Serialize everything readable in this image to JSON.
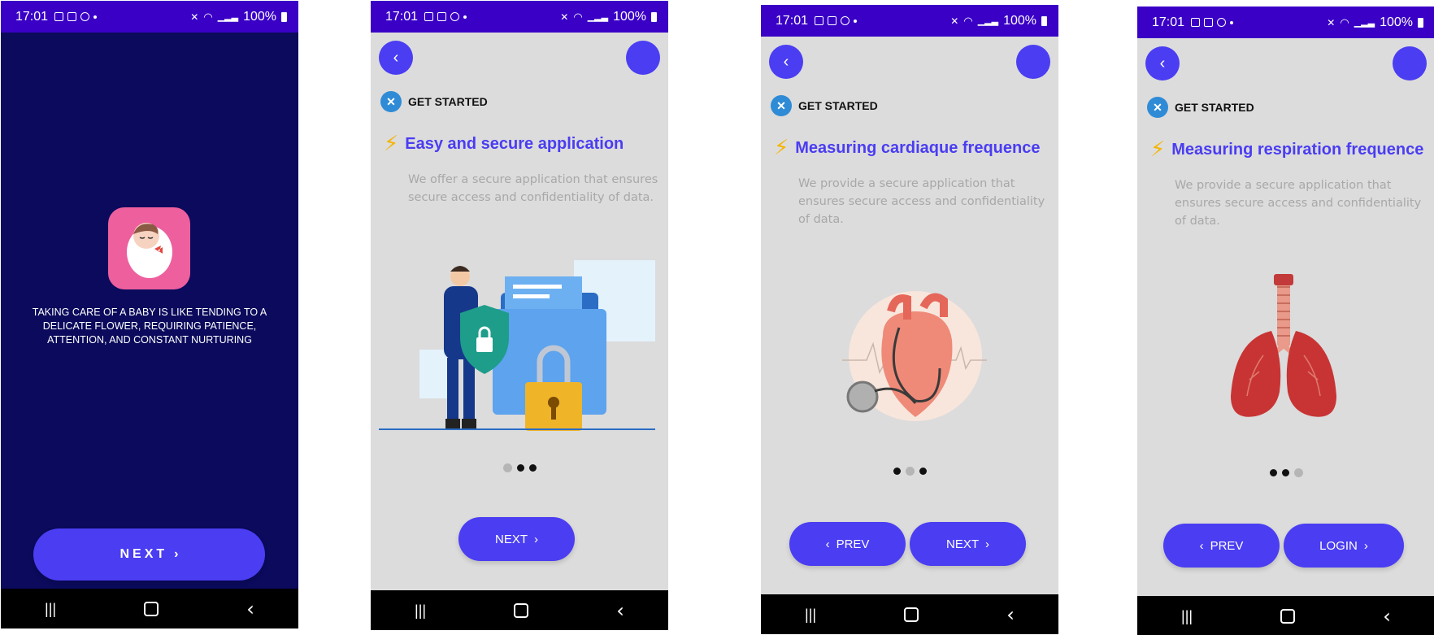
{
  "status_bar": {
    "time": "17:01",
    "battery": "100%"
  },
  "splash": {
    "tagline": "TAKING CARE OF A BABY IS LIKE TENDING TO A DELICATE FLOWER, REQUIRING PATIENCE, ATTENTION, AND CONSTANT NURTURING",
    "next_label": "NEXT",
    "background_color": "#0b0a5c"
  },
  "onboarding": {
    "get_started_label": "GET STARTED",
    "description": "We provide a secure application that ensures secure access and confidentiality of data.",
    "screen1": {
      "title": "Easy and secure application",
      "description": "We offer a secure application that ensures secure access and confidentiality of data.",
      "next_label": "NEXT",
      "active_dot": 0
    },
    "screen2": {
      "title": "Measuring cardiaque frequence",
      "prev_label": "PREV",
      "next_label": "NEXT",
      "active_dot": 1
    },
    "screen3": {
      "title": "Measuring respiration frequence",
      "prev_label": "PREV",
      "login_label": "LOGIN",
      "active_dot": 2
    }
  },
  "colors": {
    "accent": "#4a3df2",
    "status_bar": "#3a00c6",
    "content_bg": "#dcdcdc",
    "bolt": "#f5b400"
  },
  "icons": [
    "back-chevron-icon",
    "bolt-icon",
    "get-started-logo-icon",
    "recent-apps-icon",
    "home-icon",
    "back-nav-icon",
    "chevron-right-icon",
    "chevron-left-icon"
  ]
}
